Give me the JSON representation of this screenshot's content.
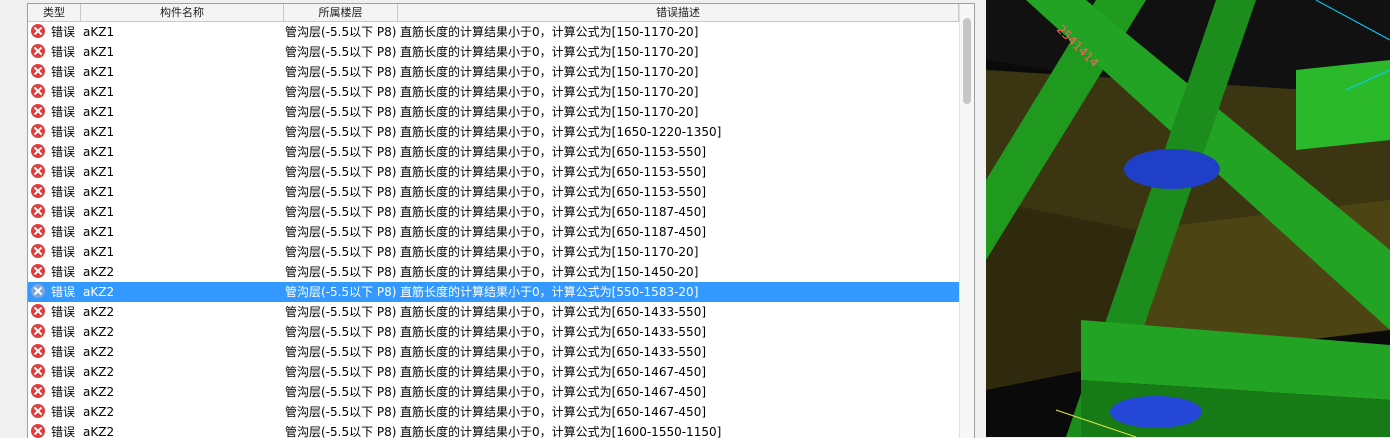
{
  "columns": {
    "type": "类型",
    "name": "构件名称",
    "floor": "所属楼层",
    "description": "错误描述"
  },
  "rows": [
    {
      "type": "错误",
      "name": "aKZ1",
      "floor": "管沟层(-5.5以下 P8)",
      "description": "直筋长度的计算结果小于0，计算公式为[150-1170-20]"
    },
    {
      "type": "错误",
      "name": "aKZ1",
      "floor": "管沟层(-5.5以下 P8)",
      "description": "直筋长度的计算结果小于0，计算公式为[150-1170-20]"
    },
    {
      "type": "错误",
      "name": "aKZ1",
      "floor": "管沟层(-5.5以下 P8)",
      "description": "直筋长度的计算结果小于0，计算公式为[150-1170-20]"
    },
    {
      "type": "错误",
      "name": "aKZ1",
      "floor": "管沟层(-5.5以下 P8)",
      "description": "直筋长度的计算结果小于0，计算公式为[150-1170-20]"
    },
    {
      "type": "错误",
      "name": "aKZ1",
      "floor": "管沟层(-5.5以下 P8)",
      "description": "直筋长度的计算结果小于0，计算公式为[150-1170-20]"
    },
    {
      "type": "错误",
      "name": "aKZ1",
      "floor": "管沟层(-5.5以下 P8)",
      "description": "直筋长度的计算结果小于0，计算公式为[1650-1220-1350]"
    },
    {
      "type": "错误",
      "name": "aKZ1",
      "floor": "管沟层(-5.5以下 P8)",
      "description": "直筋长度的计算结果小于0，计算公式为[650-1153-550]"
    },
    {
      "type": "错误",
      "name": "aKZ1",
      "floor": "管沟层(-5.5以下 P8)",
      "description": "直筋长度的计算结果小于0，计算公式为[650-1153-550]"
    },
    {
      "type": "错误",
      "name": "aKZ1",
      "floor": "管沟层(-5.5以下 P8)",
      "description": "直筋长度的计算结果小于0，计算公式为[650-1153-550]"
    },
    {
      "type": "错误",
      "name": "aKZ1",
      "floor": "管沟层(-5.5以下 P8)",
      "description": "直筋长度的计算结果小于0，计算公式为[650-1187-450]"
    },
    {
      "type": "错误",
      "name": "aKZ1",
      "floor": "管沟层(-5.5以下 P8)",
      "description": "直筋长度的计算结果小于0，计算公式为[650-1187-450]"
    },
    {
      "type": "错误",
      "name": "aKZ1",
      "floor": "管沟层(-5.5以下 P8)",
      "description": "直筋长度的计算结果小于0，计算公式为[150-1170-20]"
    },
    {
      "type": "错误",
      "name": "aKZ2",
      "floor": "管沟层(-5.5以下 P8)",
      "description": "直筋长度的计算结果小于0，计算公式为[150-1450-20]"
    },
    {
      "type": "错误",
      "name": "aKZ2",
      "floor": "管沟层(-5.5以下 P8)",
      "description": "直筋长度的计算结果小于0，计算公式为[550-1583-20]",
      "selected": true
    },
    {
      "type": "错误",
      "name": "aKZ2",
      "floor": "管沟层(-5.5以下 P8)",
      "description": "直筋长度的计算结果小于0，计算公式为[650-1433-550]"
    },
    {
      "type": "错误",
      "name": "aKZ2",
      "floor": "管沟层(-5.5以下 P8)",
      "description": "直筋长度的计算结果小于0，计算公式为[650-1433-550]"
    },
    {
      "type": "错误",
      "name": "aKZ2",
      "floor": "管沟层(-5.5以下 P8)",
      "description": "直筋长度的计算结果小于0，计算公式为[650-1433-550]"
    },
    {
      "type": "错误",
      "name": "aKZ2",
      "floor": "管沟层(-5.5以下 P8)",
      "description": "直筋长度的计算结果小于0，计算公式为[650-1467-450]"
    },
    {
      "type": "错误",
      "name": "aKZ2",
      "floor": "管沟层(-5.5以下 P8)",
      "description": "直筋长度的计算结果小于0，计算公式为[650-1467-450]"
    },
    {
      "type": "错误",
      "name": "aKZ2",
      "floor": "管沟层(-5.5以下 P8)",
      "description": "直筋长度的计算结果小于0，计算公式为[650-1467-450]"
    },
    {
      "type": "错误",
      "name": "aKZ2",
      "floor": "管沟层(-5.5以下 P8)",
      "description": "直筋长度的计算结果小于0，计算公式为[1600-1550-1150]"
    }
  ],
  "colors": {
    "selection": "#3399ff",
    "error_icon": "#e03c3c",
    "beam_green": "#23a323",
    "slab_olive": "#4a3f10",
    "hole_blue": "#1f3fc8"
  },
  "viewport": {
    "drawing_text": "2541414"
  }
}
